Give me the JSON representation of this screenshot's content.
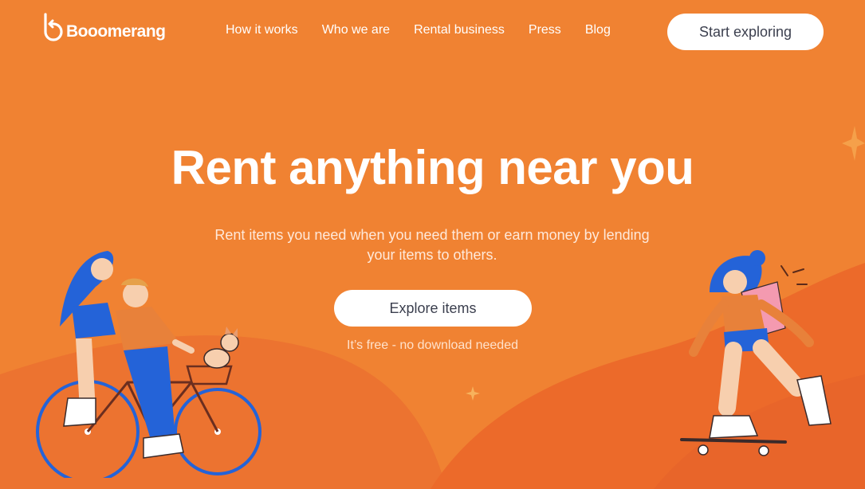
{
  "header": {
    "logo_text": "Booomerang",
    "nav": [
      {
        "label": "How it works"
      },
      {
        "label": "Who we are"
      },
      {
        "label": "Rental business"
      },
      {
        "label": "Press"
      },
      {
        "label": "Blog"
      }
    ],
    "cta_label": "Start exploring"
  },
  "hero": {
    "title": "Rent anything near you",
    "subtitle": "Rent items you need when you need them or earn money by lending your items to others.",
    "button_label": "Explore items",
    "note": "It’s free - no download needed"
  },
  "colors": {
    "background": "#F08232",
    "wave": "#EC6E2A",
    "button_text": "#3B3F4E",
    "illustration_blue": "#2463D8",
    "illustration_skin": "#F7CFAE"
  },
  "icons": [
    "boomerang-logo-icon",
    "star-icon",
    "sparkle-icon"
  ]
}
